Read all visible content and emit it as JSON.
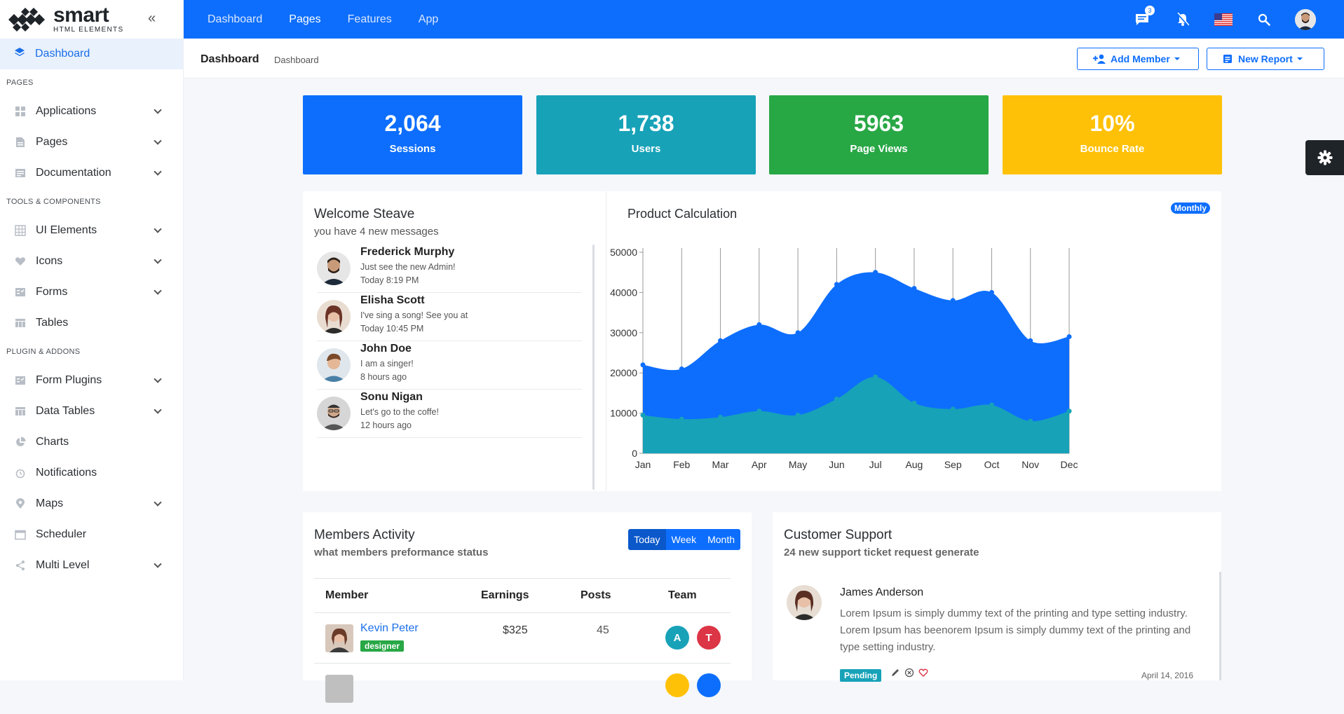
{
  "brand": {
    "name": "smart",
    "sub": "HTML ELEMENTS"
  },
  "sidebar": {
    "active": "Dashboard",
    "sections": [
      {
        "title": "PAGES",
        "items": [
          {
            "label": "Applications",
            "icon": "grid-icon",
            "chevron": true
          },
          {
            "label": "Pages",
            "icon": "page-icon",
            "chevron": true
          },
          {
            "label": "Documentation",
            "icon": "document-icon",
            "chevron": true
          }
        ]
      },
      {
        "title": "TOOLS & COMPONENTS",
        "items": [
          {
            "label": "UI Elements",
            "icon": "table-grid-icon",
            "chevron": true
          },
          {
            "label": "Icons",
            "icon": "heart-icon",
            "chevron": true
          },
          {
            "label": "Forms",
            "icon": "form-icon",
            "chevron": true
          },
          {
            "label": "Tables",
            "icon": "table-icon",
            "chevron": false
          }
        ]
      },
      {
        "title": "PLUGIN & ADDONS",
        "items": [
          {
            "label": "Form Plugins",
            "icon": "form-icon",
            "chevron": true
          },
          {
            "label": "Data Tables",
            "icon": "table-icon",
            "chevron": true
          },
          {
            "label": "Charts",
            "icon": "pie-chart-icon",
            "chevron": false
          },
          {
            "label": "Notifications",
            "icon": "alarm-icon",
            "chevron": false
          },
          {
            "label": "Maps",
            "icon": "map-pin-icon",
            "chevron": true
          },
          {
            "label": "Scheduler",
            "icon": "calendar-icon",
            "chevron": false
          },
          {
            "label": "Multi Level",
            "icon": "share-icon",
            "chevron": true
          }
        ]
      }
    ]
  },
  "topnav": {
    "items": [
      "Dashboard",
      "Pages",
      "Features",
      "App"
    ],
    "active": "Pages",
    "message_count": "3"
  },
  "subheader": {
    "title": "Dashboard",
    "crumb": "Dashboard",
    "add_member": "Add Member",
    "new_report": "New Report"
  },
  "stats": [
    {
      "value": "2,064",
      "label": "Sessions",
      "color": "#0d6efd"
    },
    {
      "value": "1,738",
      "label": "Users",
      "color": "#17a2b8"
    },
    {
      "value": "5963",
      "label": "Page Views",
      "color": "#28a745"
    },
    {
      "value": "10%",
      "label": "Bounce Rate",
      "color": "#ffc107"
    }
  ],
  "welcome": {
    "title": "Welcome Steave",
    "subtitle": "you have 4 new messages",
    "messages": [
      {
        "name": "Frederick Murphy",
        "text": "Just see the new Admin!",
        "time": "Today 8:19 PM"
      },
      {
        "name": "Elisha Scott",
        "text": "I've sing a song! See you at",
        "time": "Today 10:45 PM"
      },
      {
        "name": "John Doe",
        "text": "I am a singer!",
        "time": "8 hours ago"
      },
      {
        "name": "Sonu Nigan",
        "text": "Let's go to the coffe!",
        "time": "12 hours ago"
      }
    ]
  },
  "product": {
    "title": "Product Calculation",
    "badge": "Monthly"
  },
  "chart_data": {
    "type": "area",
    "categories": [
      "Jan",
      "Feb",
      "Mar",
      "Apr",
      "May",
      "Jun",
      "Jul",
      "Aug",
      "Sep",
      "Oct",
      "Nov",
      "Dec"
    ],
    "ylim": [
      0,
      50000
    ],
    "yticks": [
      "0",
      "10000",
      "20000",
      "30000",
      "40000",
      "50000"
    ],
    "series": [
      {
        "values": [
          22000,
          21000,
          28000,
          32000,
          30000,
          42000,
          45000,
          41000,
          38000,
          40000,
          28000,
          29000
        ],
        "color": "#0d6efd"
      },
      {
        "values": [
          9500,
          8500,
          9000,
          10500,
          9500,
          13500,
          19000,
          12500,
          11000,
          12000,
          8000,
          10500
        ],
        "color": "#17a2b8"
      }
    ]
  },
  "members": {
    "title": "Members Activity",
    "subtitle": "what members preformance status",
    "ranges": [
      "Today",
      "Week",
      "Month"
    ],
    "active_range": "Today",
    "columns": [
      "Member",
      "Earnings",
      "Posts",
      "Team"
    ],
    "rows": [
      {
        "name": "Kevin Peter",
        "tag": "designer",
        "earnings": "$325",
        "posts": "45",
        "team": [
          {
            "letter": "A",
            "color": "#17a2b8"
          },
          {
            "letter": "T",
            "color": "#dc3545"
          }
        ]
      }
    ]
  },
  "support": {
    "title": "Customer Support",
    "subtitle": "24 new support ticket request generate",
    "ticket": {
      "name": "James Anderson",
      "text": "Lorem Ipsum is simply dummy text of the printing and type setting industry. Lorem Ipsum has beenorem Ipsum is simply dummy text of the printing and type setting industry.",
      "status": "Pending",
      "date": "April 14, 2016"
    }
  }
}
